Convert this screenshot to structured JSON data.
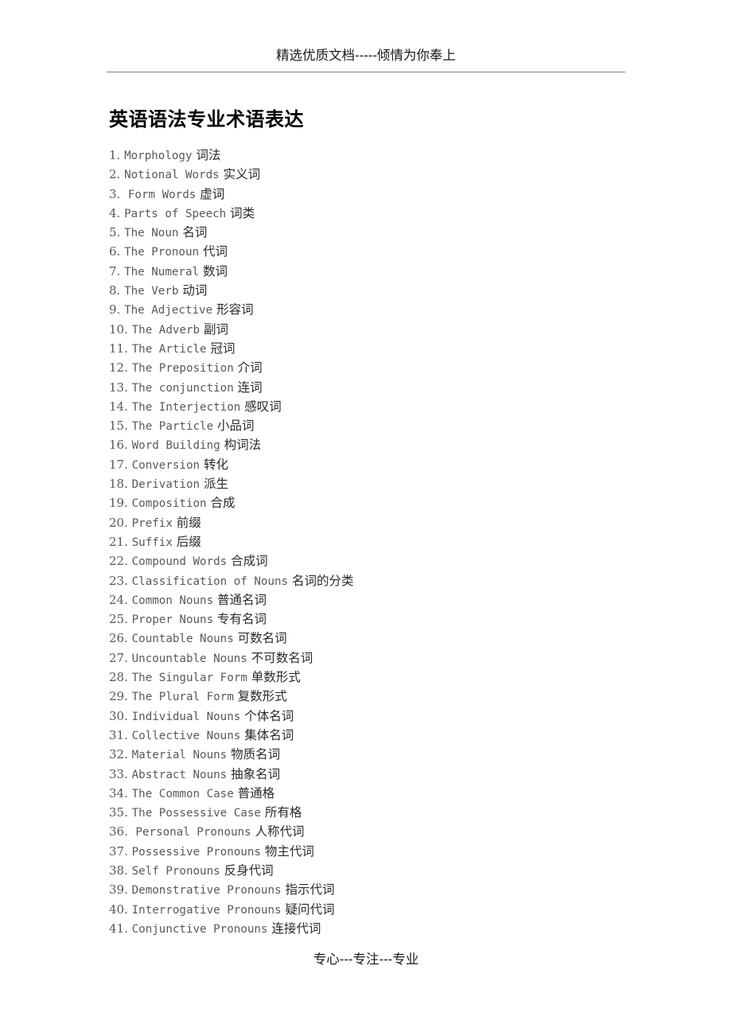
{
  "header": {
    "text": "精选优质文档-----倾情为你奉上"
  },
  "title": "英语语法专业术语表达",
  "footer": {
    "text": "专心---专注---专业"
  },
  "list": {
    "items": [
      {
        "num": "1.",
        "gap": " ",
        "en": "Morphology",
        "zh": " 词法"
      },
      {
        "num": "2.",
        "gap": " ",
        "en": "Notional Words",
        "zh": " 实义词"
      },
      {
        "num": "3.",
        "gap": "  ",
        "en": "Form Words",
        "zh": " 虚词"
      },
      {
        "num": "4.",
        "gap": " ",
        "en": "Parts of Speech",
        "zh": " 词类"
      },
      {
        "num": "5.",
        "gap": " ",
        "en": "The Noun",
        "zh": " 名词"
      },
      {
        "num": "6.",
        "gap": " ",
        "en": "The Pronoun",
        "zh": " 代词"
      },
      {
        "num": "7.",
        "gap": " ",
        "en": "The Numeral",
        "zh": " 数词"
      },
      {
        "num": "8.",
        "gap": " ",
        "en": "The Verb",
        "zh": " 动词"
      },
      {
        "num": "9.",
        "gap": " ",
        "en": "The Adjective",
        "zh": " 形容词"
      },
      {
        "num": "10.",
        "gap": " ",
        "en": "The Adverb",
        "zh": " 副词"
      },
      {
        "num": "11.",
        "gap": " ",
        "en": "The Article",
        "zh": " 冠词"
      },
      {
        "num": "12.",
        "gap": " ",
        "en": "The Preposition",
        "zh": " 介词"
      },
      {
        "num": "13.",
        "gap": " ",
        "en": "The conjunction",
        "zh": " 连词"
      },
      {
        "num": "14.",
        "gap": " ",
        "en": "The Interjection",
        "zh": " 感叹词"
      },
      {
        "num": "15.",
        "gap": " ",
        "en": "The Particle",
        "zh": " 小品词"
      },
      {
        "num": "16.",
        "gap": " ",
        "en": "Word Building",
        "zh": " 构词法"
      },
      {
        "num": "17.",
        "gap": " ",
        "en": "Conversion",
        "zh": " 转化"
      },
      {
        "num": "18.",
        "gap": " ",
        "en": "Derivation",
        "zh": " 派生"
      },
      {
        "num": "19.",
        "gap": " ",
        "en": "Composition",
        "zh": " 合成"
      },
      {
        "num": "20.",
        "gap": " ",
        "en": "Prefix",
        "zh": " 前缀"
      },
      {
        "num": "21.",
        "gap": " ",
        "en": "Suffix",
        "zh": " 后缀"
      },
      {
        "num": "22.",
        "gap": " ",
        "en": "Compound Words",
        "zh": " 合成词"
      },
      {
        "num": "23.",
        "gap": " ",
        "en": "Classification of Nouns",
        "zh": " 名词的分类"
      },
      {
        "num": "24.",
        "gap": " ",
        "en": "Common Nouns",
        "zh": " 普通名词"
      },
      {
        "num": "25.",
        "gap": " ",
        "en": "Proper Nouns",
        "zh": " 专有名词"
      },
      {
        "num": "26.",
        "gap": " ",
        "en": "Countable Nouns",
        "zh": " 可数名词"
      },
      {
        "num": "27.",
        "gap": " ",
        "en": "Uncountable Nouns",
        "zh": " 不可数名词"
      },
      {
        "num": "28.",
        "gap": " ",
        "en": "The Singular Form",
        "zh": " 单数形式"
      },
      {
        "num": "29.",
        "gap": " ",
        "en": "The Plural Form",
        "zh": " 复数形式"
      },
      {
        "num": "30.",
        "gap": " ",
        "en": "Individual Nouns",
        "zh": " 个体名词"
      },
      {
        "num": "31.",
        "gap": " ",
        "en": "Collective Nouns",
        "zh": " 集体名词"
      },
      {
        "num": "32.",
        "gap": " ",
        "en": "Material Nouns",
        "zh": " 物质名词"
      },
      {
        "num": "33.",
        "gap": " ",
        "en": "Abstract Nouns",
        "zh": " 抽象名词"
      },
      {
        "num": "34.",
        "gap": " ",
        "en": "The Common Case",
        "zh": " 普通格"
      },
      {
        "num": "35.",
        "gap": " ",
        "en": "The Possessive Case",
        "zh": " 所有格"
      },
      {
        "num": "36.",
        "gap": "  ",
        "en": "Personal Pronouns",
        "zh": " 人称代词"
      },
      {
        "num": "37.",
        "gap": " ",
        "en": "Possessive Pronouns",
        "zh": " 物主代词"
      },
      {
        "num": "38.",
        "gap": " ",
        "en": "Self Pronouns",
        "zh": " 反身代词"
      },
      {
        "num": "39.",
        "gap": " ",
        "en": "Demonstrative Pronouns",
        "zh": " 指示代词"
      },
      {
        "num": "40.",
        "gap": " ",
        "en": "Interrogative Pronouns",
        "zh": " 疑问代词"
      },
      {
        "num": "41.",
        "gap": " ",
        "en": "Conjunctive Pronouns",
        "zh": " 连接代词"
      }
    ]
  }
}
